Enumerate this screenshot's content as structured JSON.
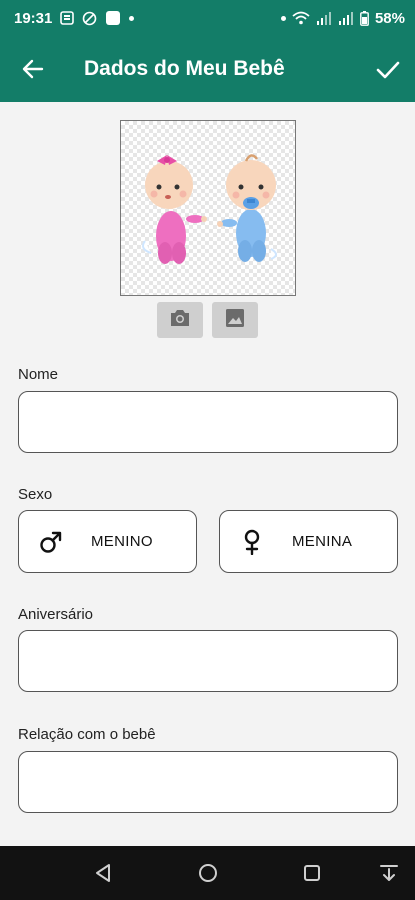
{
  "status_bar": {
    "time": "19:31",
    "battery": "58%",
    "left_icons": [
      "sms-icon",
      "sync-off-icon",
      "app-square-icon",
      "dot-icon"
    ],
    "right_icons": [
      "dot-icon",
      "wifi-icon",
      "signal-icon",
      "signal-icon",
      "battery-icon"
    ]
  },
  "app_bar": {
    "title": "Dados do Meu Bebê",
    "back_icon": "arrow-left-icon",
    "confirm_icon": "check-icon"
  },
  "photo": {
    "camera_icon": "camera-icon",
    "gallery_icon": "image-icon"
  },
  "form": {
    "name_label": "Nome",
    "name_value": "",
    "sex_label": "Sexo",
    "sex_options": [
      {
        "label": "MENINO",
        "icon": "male-symbol-icon"
      },
      {
        "label": "MENINA",
        "icon": "female-symbol-icon"
      }
    ],
    "birthday_label": "Aniversário",
    "birthday_value": "",
    "relation_label": "Relação com o bebê",
    "relation_value": ""
  },
  "nav_bar": {
    "icons": [
      "back-triangle-icon",
      "home-circle-icon",
      "recents-square-icon",
      "keyboard-hide-icon"
    ]
  },
  "colors": {
    "primary": "#137d68",
    "background": "#f3f3f3",
    "nav_bar": "#121212",
    "girl_pink": "#e868b8",
    "boy_blue": "#7fb6ec"
  }
}
